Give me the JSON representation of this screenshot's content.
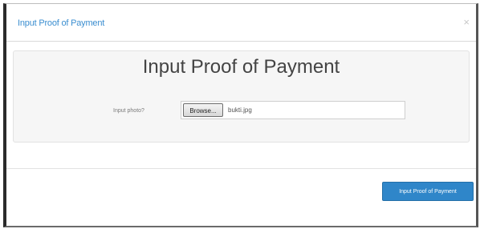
{
  "modal": {
    "header_title": "Input Proof of Payment",
    "close_label": "×",
    "panel_title": "Input Proof of Payment",
    "field_label": "Input photo?",
    "browse_label": "Browse...",
    "file_name": "bukti.jpg",
    "submit_label": "Input Proof of Payment"
  },
  "colors": {
    "accent": "#2f86c9",
    "header_text": "#3b8ed0",
    "panel_bg": "#f6f6f6"
  }
}
